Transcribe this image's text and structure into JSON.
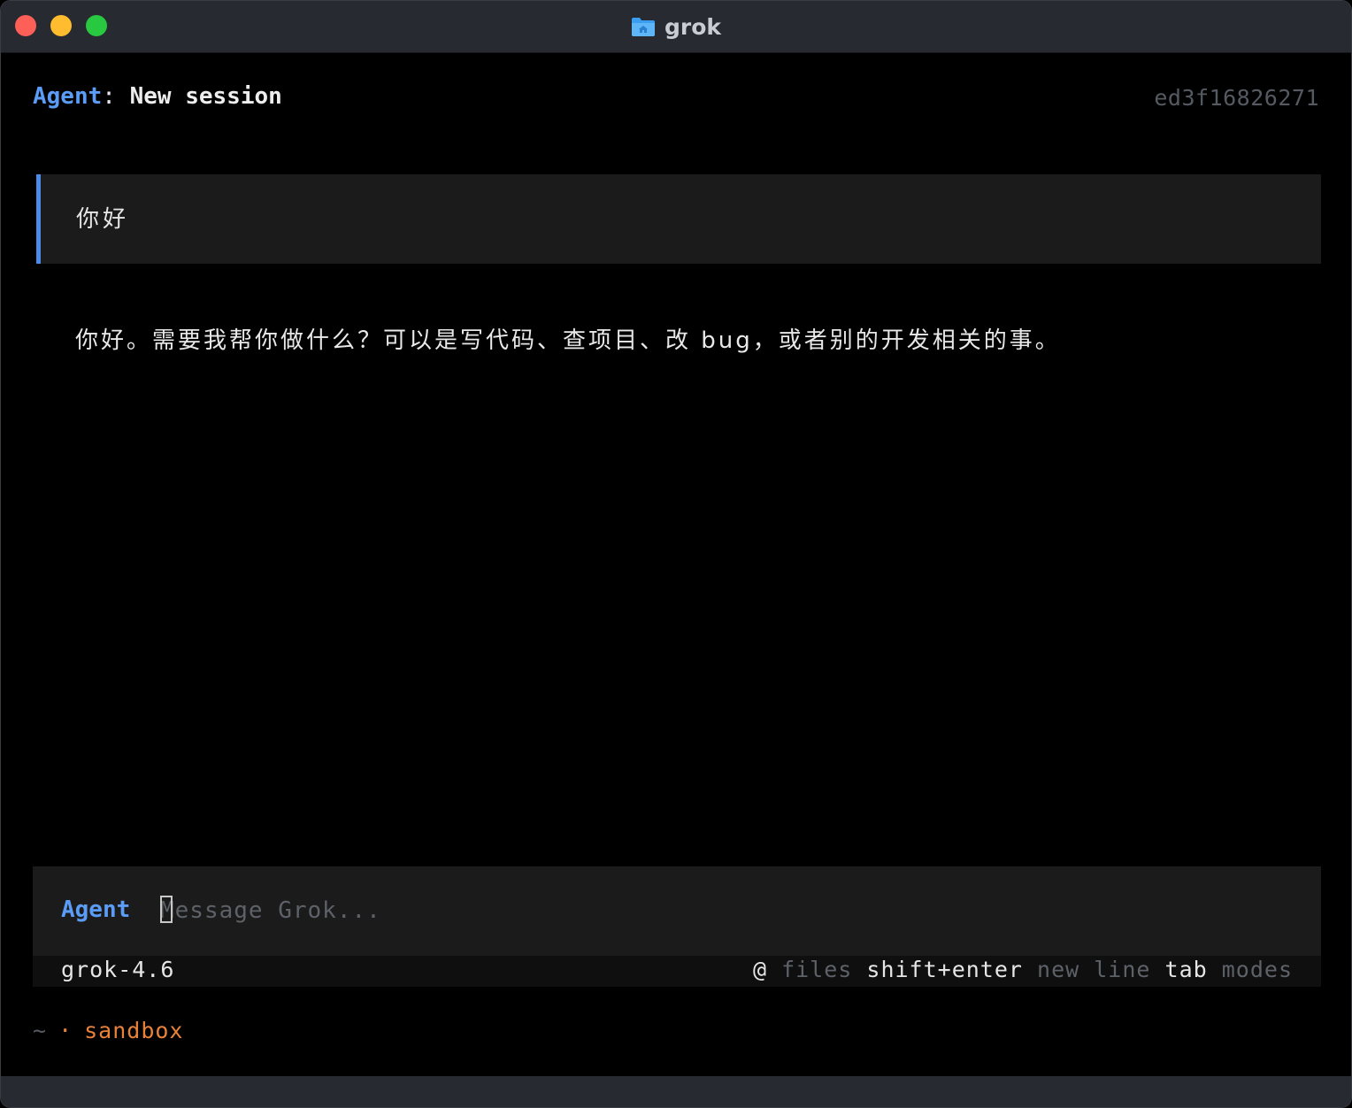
{
  "window": {
    "title": "grok",
    "title_icon": "home-folder-icon"
  },
  "header": {
    "mode": "Agent",
    "separator": ":",
    "session_title": "New session",
    "session_id": "ed3f16826271"
  },
  "conversation": {
    "user_message": "你好",
    "assistant_message": "你好。需要我帮你做什么？可以是写代码、查项目、改 bug，或者别的开发相关的事。"
  },
  "composer": {
    "mode": "Agent",
    "placeholder": "Message Grok...",
    "value": ""
  },
  "statusbar": {
    "model": "grok-4.6",
    "hints": [
      {
        "key": "@",
        "desc": "files"
      },
      {
        "key": "shift+enter",
        "desc": "new line"
      },
      {
        "key": "tab",
        "desc": "modes"
      }
    ]
  },
  "footer": {
    "path": "~",
    "separator": "·",
    "environment": "sandbox"
  },
  "colors": {
    "accent_blue": "#5b9cf6",
    "env_orange": "#e8823a",
    "titlebar": "#272a31",
    "panel": "#1b1b1b"
  }
}
